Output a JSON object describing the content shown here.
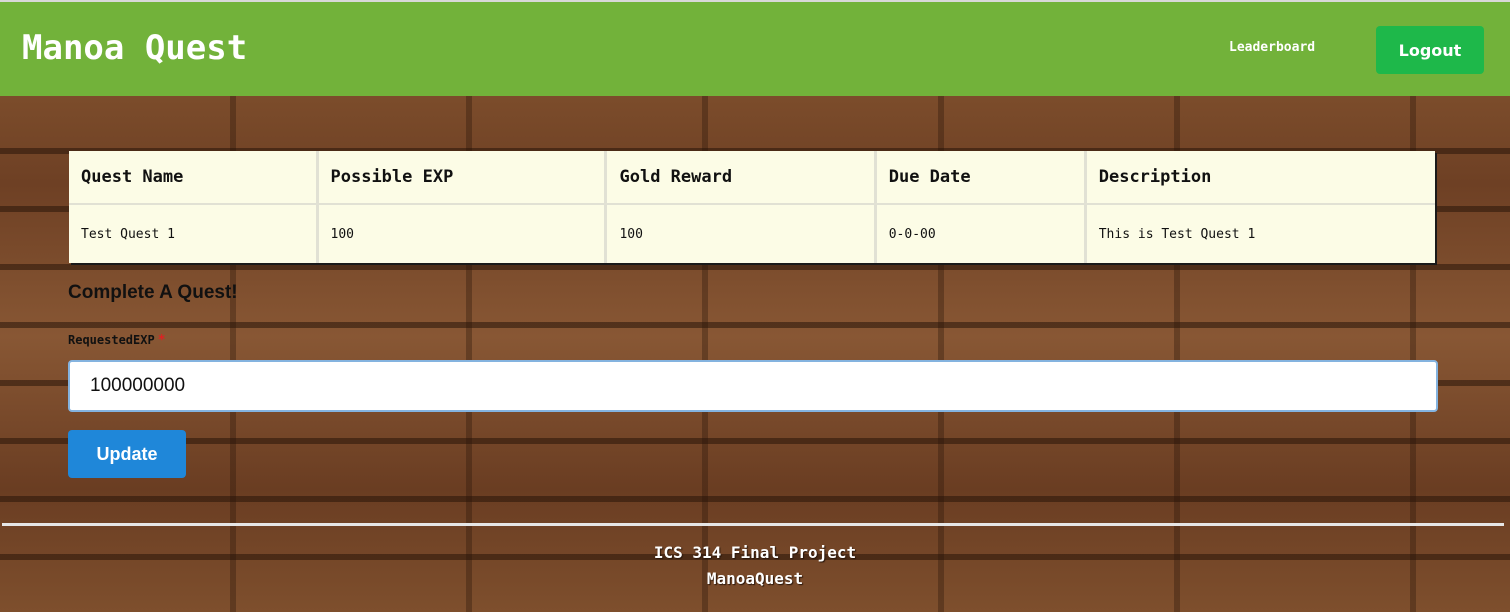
{
  "header": {
    "brand": "Manoa Quest",
    "nav_leaderboard": "Leaderboard",
    "logout_label": "Logout"
  },
  "quest_table": {
    "headers": [
      "Quest Name",
      "Possible EXP",
      "Gold Reward",
      "Due Date",
      "Description"
    ],
    "rows": [
      [
        "Test Quest 1",
        "100",
        "100",
        "0-0-00",
        "This is Test Quest 1"
      ]
    ]
  },
  "form": {
    "title": "Complete A Quest!",
    "field_label": "RequestedEXP",
    "required_mark": "*",
    "field_value": "100000000",
    "submit_label": "Update"
  },
  "footer": {
    "line1": "ICS 314 Final Project",
    "line2": "ManoaQuest"
  },
  "colors": {
    "navbar": "#72b23a",
    "logout_button": "#1eb84a",
    "update_button": "#1f87d9",
    "table_background": "#fcfce6"
  }
}
